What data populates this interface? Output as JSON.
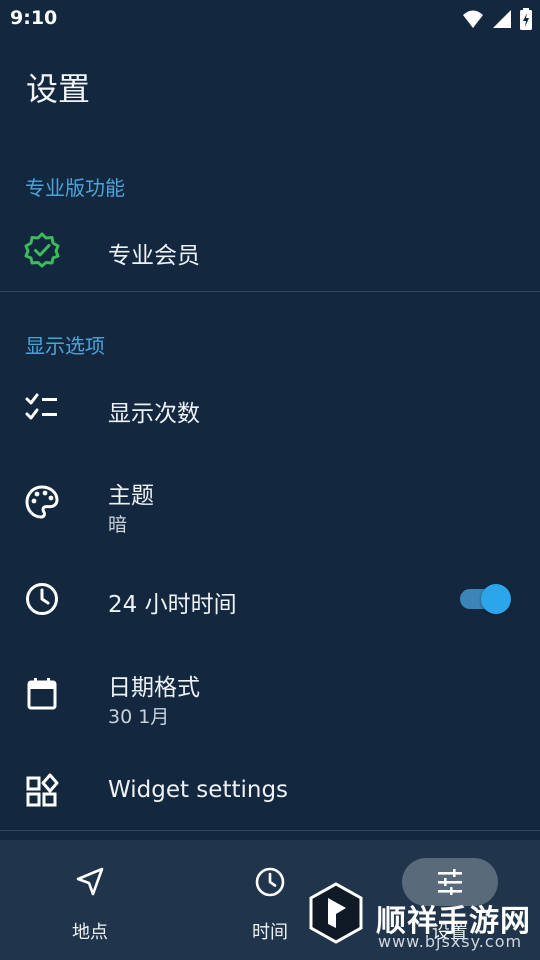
{
  "status_bar": {
    "time": "9:10",
    "icons": [
      "wifi-icon",
      "signal-icon",
      "battery-charging-icon"
    ]
  },
  "header": {
    "title": "设置"
  },
  "sections": [
    {
      "header": "专业版功能"
    },
    {
      "header": "显示选项"
    }
  ],
  "items": {
    "pro": {
      "title": "专业会员",
      "icon": "verified-badge-icon",
      "icon_color": "#3dbb5a"
    },
    "show_count": {
      "title": "显示次数",
      "icon": "checklist-icon"
    },
    "theme": {
      "title": "主题",
      "value": "暗",
      "icon": "palette-icon"
    },
    "time24": {
      "title": "24 小时时间",
      "icon": "clock-icon",
      "enabled": true
    },
    "date_format": {
      "title": "日期格式",
      "value": "30 1月",
      "icon": "calendar-icon"
    },
    "widget": {
      "title": "Widget settings",
      "icon": "widgets-icon"
    }
  },
  "bottom_nav": [
    {
      "label": "地点",
      "icon": "navigation-arrow-icon",
      "active": false
    },
    {
      "label": "时间",
      "icon": "clock-icon",
      "active": false
    },
    {
      "label": "设置",
      "icon": "tune-sliders-icon",
      "active": true
    }
  ],
  "watermark": {
    "text": "顺祥手游网",
    "url": "www.bjsxsy.com"
  },
  "colors": {
    "background": "#13283f",
    "accent": "#4aa3d9",
    "toggle": "#2ca6ea",
    "nav_background": "#20354b"
  }
}
